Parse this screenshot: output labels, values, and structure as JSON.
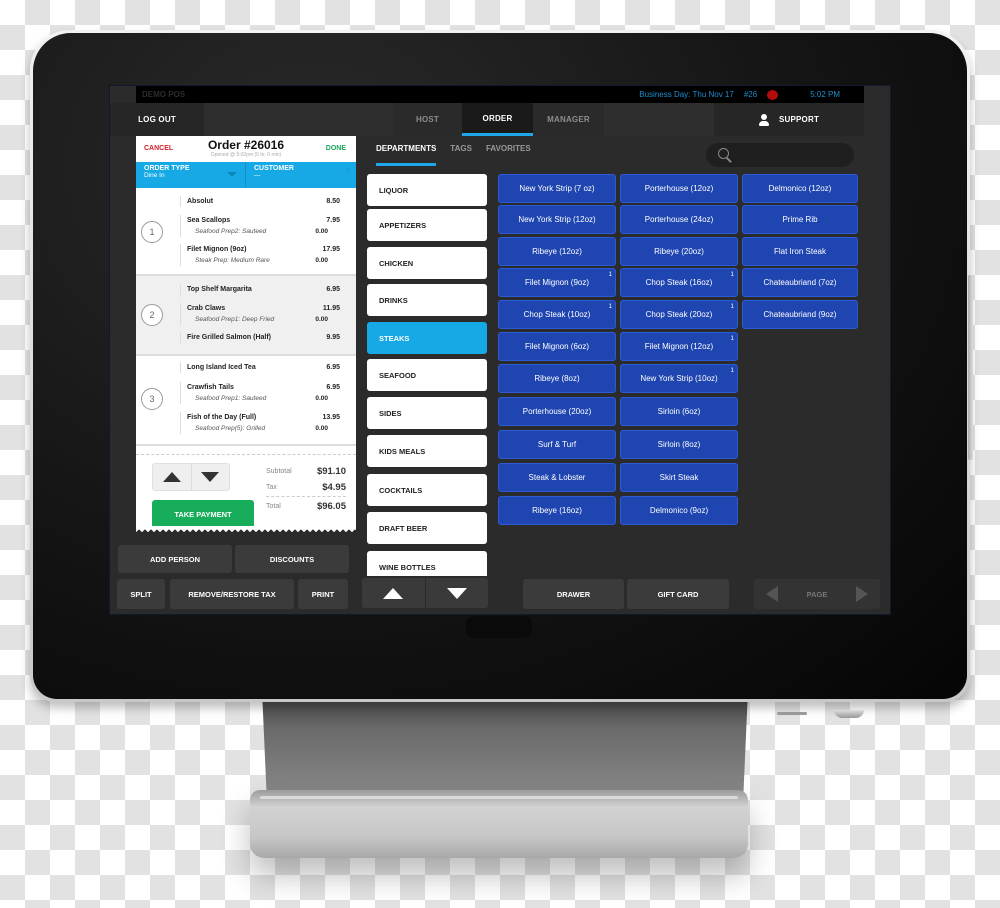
{
  "status_bar": {
    "left_text": "DEMO POS",
    "business_day": "Business Day: Thu Nov 17",
    "terminal": "#26",
    "time": "5:02 PM"
  },
  "top_nav": {
    "logout": "LOG OUT",
    "tabs": [
      {
        "label": "HOST",
        "active": false
      },
      {
        "label": "ORDER",
        "active": true
      },
      {
        "label": "MANAGER",
        "active": false
      }
    ],
    "support": "SUPPORT"
  },
  "order": {
    "cancel": "CANCEL",
    "done": "DONE",
    "title": "Order #26016",
    "opened": "Opened @ 5:02pm (0 hr, 0 min)",
    "order_type_label": "ORDER TYPE",
    "order_type_value": "Dine In",
    "customer_label": "CUSTOMER",
    "customer_value": "—",
    "seats": [
      {
        "number": "1",
        "items": [
          {
            "name": "Absolut",
            "price": "8.50"
          },
          {
            "name": "Sea Scallops",
            "price": "7.95",
            "modifier": "Seafood Prep2: Sauteed",
            "mod_price": "0.00"
          },
          {
            "name": "Filet Mignon (9oz)",
            "price": "17.95",
            "modifier": "Steak Prep: Medium Rare",
            "mod_price": "0.00"
          }
        ]
      },
      {
        "number": "2",
        "items": [
          {
            "name": "Top Shelf Margarita",
            "price": "6.95"
          },
          {
            "name": "Crab Claws",
            "price": "11.95",
            "modifier": "Seafood Prep1: Deep Fried",
            "mod_price": "0.00"
          },
          {
            "name": "Fire Grilled Salmon (Half)",
            "price": "9.95"
          }
        ]
      },
      {
        "number": "3",
        "items": [
          {
            "name": "Long Island Iced Tea",
            "price": "6.95"
          },
          {
            "name": "Crawfish Tails",
            "price": "6.95",
            "modifier": "Seafood Prep1: Sauteed",
            "mod_price": "0.00"
          },
          {
            "name": "Fish of the Day (Full)",
            "price": "13.95",
            "modifier": "Seafood Prep(5): Grilled",
            "mod_price": "0.00"
          }
        ]
      }
    ],
    "subtotal_label": "Subtotal",
    "subtotal": "$91.10",
    "tax_label": "Tax",
    "tax": "$4.95",
    "total_label": "Total",
    "total": "$96.05",
    "take_payment": "TAKE PAYMENT"
  },
  "actions": {
    "add_person": "ADD PERSON",
    "discounts": "DISCOUNTS",
    "split": "SPLIT",
    "remove_restore_tax": "REMOVE/RESTORE TAX",
    "print": "PRINT"
  },
  "category_tabs": [
    {
      "label": "DEPARTMENTS",
      "active": true
    },
    {
      "label": "TAGS",
      "active": false
    },
    {
      "label": "FAVORITES",
      "active": false
    }
  ],
  "search": {
    "placeholder": "",
    "value": ""
  },
  "departments": [
    {
      "label": "LIQUOR",
      "active": false
    },
    {
      "label": "APPETIZERS",
      "active": false
    },
    {
      "label": "CHICKEN",
      "active": false
    },
    {
      "label": "DRINKS",
      "active": false
    },
    {
      "label": "STEAKS",
      "active": true
    },
    {
      "label": "SEAFOOD",
      "active": false
    },
    {
      "label": "SIDES",
      "active": false
    },
    {
      "label": "KIDS MEALS",
      "active": false
    },
    {
      "label": "COCKTAILS",
      "active": false
    },
    {
      "label": "DRAFT BEER",
      "active": false
    },
    {
      "label": "WINE BOTTLES",
      "active": false
    }
  ],
  "menu_columns": [
    [
      {
        "label": "New York Strip (7 oz)"
      },
      {
        "label": "New York Strip (12oz)"
      },
      {
        "label": "Ribeye (12oz)"
      },
      {
        "label": "Filet Mignon (9oz)",
        "badge": "1"
      },
      {
        "label": "Chop Steak (10oz)",
        "badge": "1"
      },
      {
        "label": "Filet Mignon (6oz)"
      },
      {
        "label": "Ribeye (8oz)"
      },
      {
        "label": "Porterhouse (20oz)"
      },
      {
        "label": "Surf & Turf"
      },
      {
        "label": "Steak & Lobster"
      },
      {
        "label": "Ribeye (16oz)"
      }
    ],
    [
      {
        "label": "Porterhouse (12oz)"
      },
      {
        "label": "Porterhouse (24oz)"
      },
      {
        "label": "Ribeye (20oz)"
      },
      {
        "label": "Chop Steak (16oz)",
        "badge": "1"
      },
      {
        "label": "Chop Steak (20oz)",
        "badge": "1"
      },
      {
        "label": "Filet Mignon (12oz)",
        "badge": "1"
      },
      {
        "label": "New York Strip (10oz)",
        "badge": "1"
      },
      {
        "label": "Sirloin (6oz)"
      },
      {
        "label": "Sirloin (8oz)"
      },
      {
        "label": "Skirt Steak"
      },
      {
        "label": "Delmonico (9oz)"
      }
    ],
    [
      {
        "label": "Delmonico (12oz)"
      },
      {
        "label": "Prime Rib"
      },
      {
        "label": "Flat Iron Steak"
      },
      {
        "label": "Chateaubriand (7oz)"
      },
      {
        "label": "Chateaubriand (9oz)"
      }
    ]
  ],
  "bottom_bar": {
    "drawer": "DRAWER",
    "gift_card": "GIFT CARD",
    "page": "PAGE"
  },
  "colors": {
    "accent_blue": "#16a9e6",
    "menu_blue": "#1f45b1",
    "payment_green": "#17ad5b",
    "cancel_red": "#d3222a"
  }
}
